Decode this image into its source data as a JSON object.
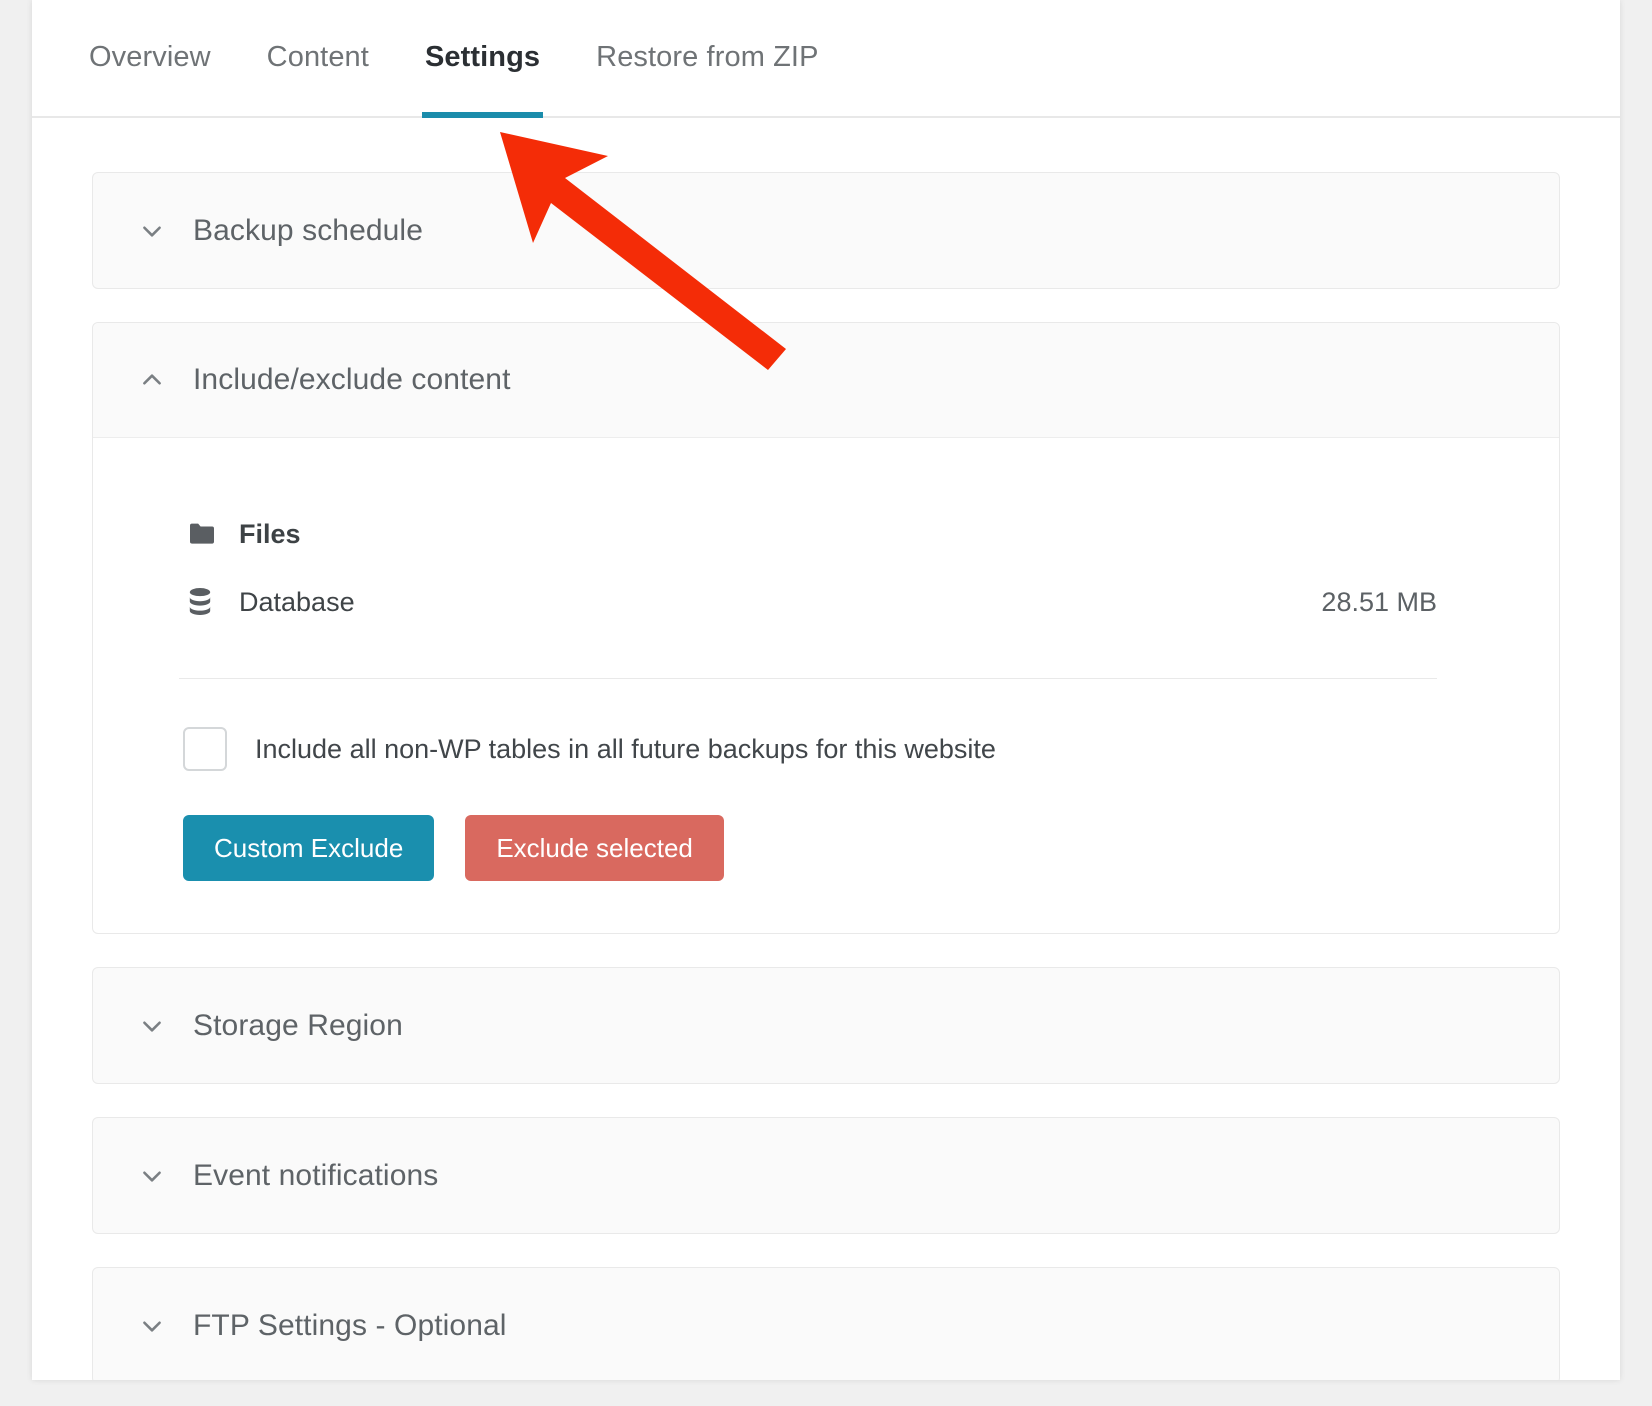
{
  "tabs": [
    {
      "label": "Overview",
      "active": false
    },
    {
      "label": "Content",
      "active": false
    },
    {
      "label": "Settings",
      "active": true
    },
    {
      "label": "Restore from ZIP",
      "active": false
    }
  ],
  "colors": {
    "active_tab_underline": "#1a8cab",
    "primary_button": "#1a8fae",
    "danger_button": "#d9695f",
    "annotation_arrow": "#f42c07"
  },
  "sections": {
    "backup_schedule": {
      "title": "Backup schedule",
      "expanded": false,
      "chevron": "chevron-down-icon"
    },
    "include_exclude": {
      "title": "Include/exclude content",
      "expanded": true,
      "chevron": "chevron-up-icon"
    },
    "storage_region": {
      "title": "Storage Region",
      "expanded": false,
      "chevron": "chevron-down-icon"
    },
    "event_notifications": {
      "title": "Event notifications",
      "expanded": false,
      "chevron": "chevron-down-icon"
    },
    "ftp_settings": {
      "title": "FTP Settings - Optional",
      "expanded": false,
      "chevron": "chevron-down-icon"
    }
  },
  "include_exclude_content": {
    "rows": [
      {
        "icon": "folder-icon",
        "label": "Files",
        "size": ""
      },
      {
        "icon": "database-icon",
        "label": "Database",
        "size": "28.51 MB"
      }
    ],
    "checkbox": {
      "label": "Include all non-WP tables in all future backups for this website",
      "checked": false
    },
    "buttons": {
      "custom_exclude": "Custom Exclude",
      "exclude_selected": "Exclude selected"
    }
  }
}
